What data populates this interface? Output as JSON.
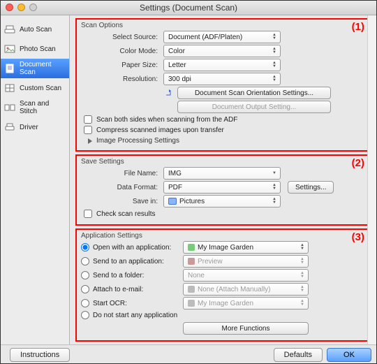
{
  "window": {
    "title": "Settings (Document Scan)"
  },
  "sidebar": {
    "items": [
      {
        "label": "Auto Scan",
        "selected": false
      },
      {
        "label": "Photo Scan",
        "selected": false
      },
      {
        "label": "Document Scan",
        "selected": true
      },
      {
        "label": "Custom Scan",
        "selected": false
      },
      {
        "label": "Scan and Stitch",
        "selected": false
      },
      {
        "label": "Driver",
        "selected": false
      }
    ]
  },
  "scan_options": {
    "title": "Scan Options",
    "marker": "(1)",
    "select_source": {
      "label": "Select Source:",
      "value": "Document (ADF/Platen)"
    },
    "color_mode": {
      "label": "Color Mode:",
      "value": "Color"
    },
    "paper_size": {
      "label": "Paper Size:",
      "value": "Letter"
    },
    "resolution": {
      "label": "Resolution:",
      "value": "300 dpi"
    },
    "orientation_btn": "Document Scan Orientation Settings...",
    "output_btn": "Document Output Setting...",
    "scan_both_sides": "Scan both sides when scanning from the ADF",
    "compress": "Compress scanned images upon transfer",
    "image_processing": "Image Processing Settings"
  },
  "save_settings": {
    "title": "Save Settings",
    "marker": "(2)",
    "file_name": {
      "label": "File Name:",
      "value": "IMG"
    },
    "data_format": {
      "label": "Data Format:",
      "value": "PDF"
    },
    "settings_btn": "Settings...",
    "save_in": {
      "label": "Save in:",
      "value": "Pictures"
    },
    "check_results": "Check scan results"
  },
  "app_settings": {
    "title": "Application Settings",
    "marker": "(3)",
    "options": [
      {
        "label": "Open with an application:",
        "value": "My Image Garden",
        "checked": true,
        "enabled": true,
        "icon": "app"
      },
      {
        "label": "Send to an application:",
        "value": "Preview",
        "checked": false,
        "enabled": false,
        "icon": "appp"
      },
      {
        "label": "Send to a folder:",
        "value": "None",
        "checked": false,
        "enabled": false,
        "icon": ""
      },
      {
        "label": "Attach to e-mail:",
        "value": "None (Attach Manually)",
        "checked": false,
        "enabled": false,
        "icon": "appg"
      },
      {
        "label": "Start OCR:",
        "value": "My Image Garden",
        "checked": false,
        "enabled": false,
        "icon": "appg"
      },
      {
        "label": "Do not start any application",
        "value": "",
        "checked": false,
        "enabled": true,
        "icon": ""
      }
    ],
    "more": "More Functions"
  },
  "footer": {
    "instructions": "Instructions",
    "defaults": "Defaults",
    "ok": "OK"
  }
}
